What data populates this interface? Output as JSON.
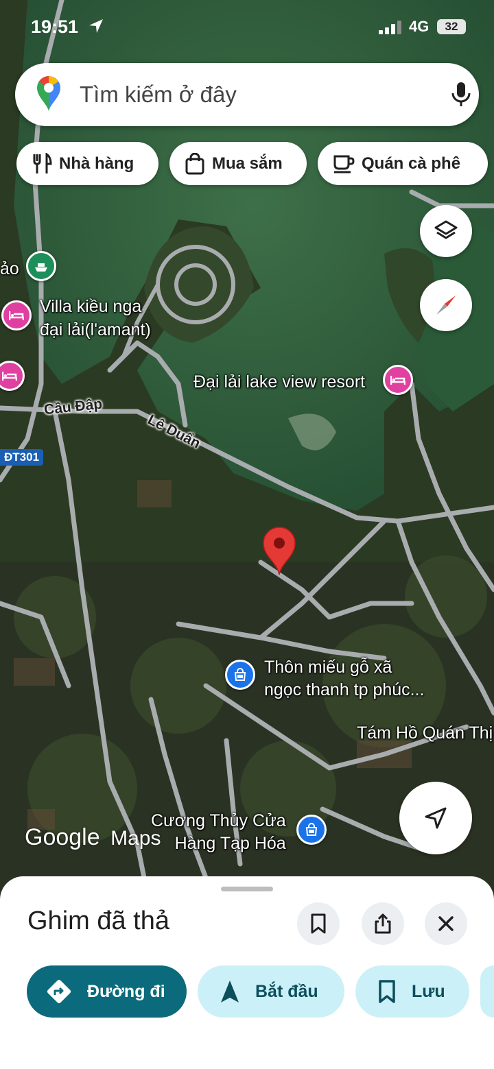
{
  "status_bar": {
    "time": "19:51",
    "network": "4G",
    "battery": "32"
  },
  "search": {
    "placeholder": "Tìm kiếm ở đây"
  },
  "chips": [
    {
      "label": "Nhà hàng",
      "icon": "restaurant-icon"
    },
    {
      "label": "Mua sắm",
      "icon": "shopping-bag-icon"
    },
    {
      "label": "Quán cà phê",
      "icon": "coffee-cup-icon"
    }
  ],
  "map": {
    "places": {
      "villa": "Villa kiều nga\nđại lải(l'amant)",
      "resort": "Đại lải lake view resort",
      "thon_mieu": "Thôn miếu gỗ xã\nngọc thanh tp phúc...",
      "tam_ho": "Tám Hồ Quán Thị",
      "cuong_thuy": "Cương Thủy Cửa\nHàng Tạp Hóa",
      "left_edge": "ảo"
    },
    "roads": {
      "cau_dap": "Cầu Đập",
      "le_duan": "Lê Duẩn",
      "dt301": "ĐT301"
    },
    "colors": {
      "lake": "#2e5e3c",
      "land": "#2b3a22",
      "road": "#a8acae",
      "pin": "#e53935"
    }
  },
  "logo": {
    "google": "Google",
    "maps": "Maps"
  },
  "sheet": {
    "title": "Ghim đã thả",
    "actions": [
      {
        "label": "Đường đi",
        "icon": "directions-icon"
      },
      {
        "label": "Bắt đầu",
        "icon": "navigation-arrow-icon"
      },
      {
        "label": "Lưu",
        "icon": "bookmark-icon"
      }
    ]
  }
}
